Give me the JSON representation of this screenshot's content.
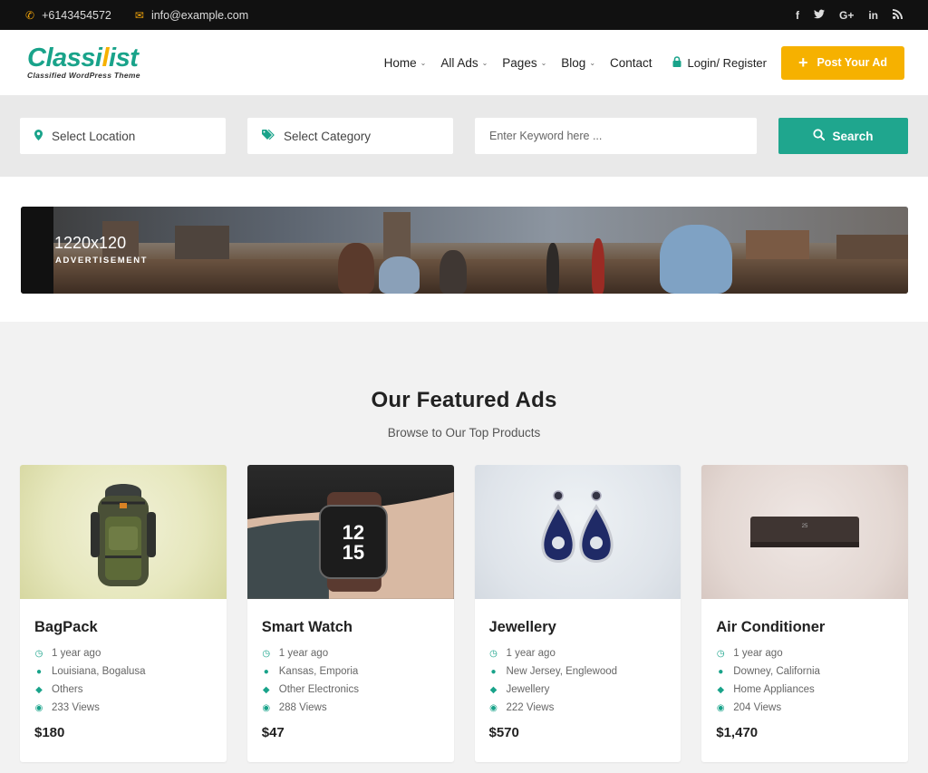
{
  "topbar": {
    "phone": "+6143454572",
    "email": "info@example.com",
    "phone_icon": "phone-icon",
    "email_icon": "envelope-icon",
    "social": [
      "f",
      "t",
      "G+",
      "in",
      "rss"
    ]
  },
  "header": {
    "logo_main": "Classi",
    "logo_accent": "l",
    "logo_rest": "ist",
    "logo_tagline": "Classified WordPress Theme",
    "nav": {
      "home": "Home",
      "all_ads": "All Ads",
      "pages": "Pages",
      "blog": "Blog",
      "contact": "Contact",
      "login": "Login/ Register"
    },
    "post_button": "Post Your Ad"
  },
  "search": {
    "location": "Select Location",
    "category": "Select Category",
    "keyword_placeholder": "Enter Keyword here ...",
    "button": "Search"
  },
  "ad_banner": {
    "size": "1220x120",
    "label": "ADVERTISEMENT"
  },
  "featured": {
    "title": "Our Featured Ads",
    "subtitle": "Browse to Our Top Products",
    "items": [
      {
        "title": "BagPack",
        "time": "1 year ago",
        "location": "Louisiana, Bogalusa",
        "category": "Others",
        "views": "233 Views",
        "price": "$180"
      },
      {
        "title": "Smart Watch",
        "time": "1 year ago",
        "location": "Kansas, Emporia",
        "category": "Other Electronics",
        "views": "288 Views",
        "price": "$47"
      },
      {
        "title": "Jewellery",
        "time": "1 year ago",
        "location": "New Jersey, Englewood",
        "category": "Jewellery",
        "views": "222 Views",
        "price": "$570"
      },
      {
        "title": "Air Conditioner",
        "time": "1 year ago",
        "location": "Downey, California",
        "category": "Home Appliances",
        "views": "204 Views",
        "price": "$1,470"
      }
    ]
  },
  "colors": {
    "accent": "#19a38a",
    "highlight": "#f6b100",
    "topbar_bg": "#111111"
  }
}
